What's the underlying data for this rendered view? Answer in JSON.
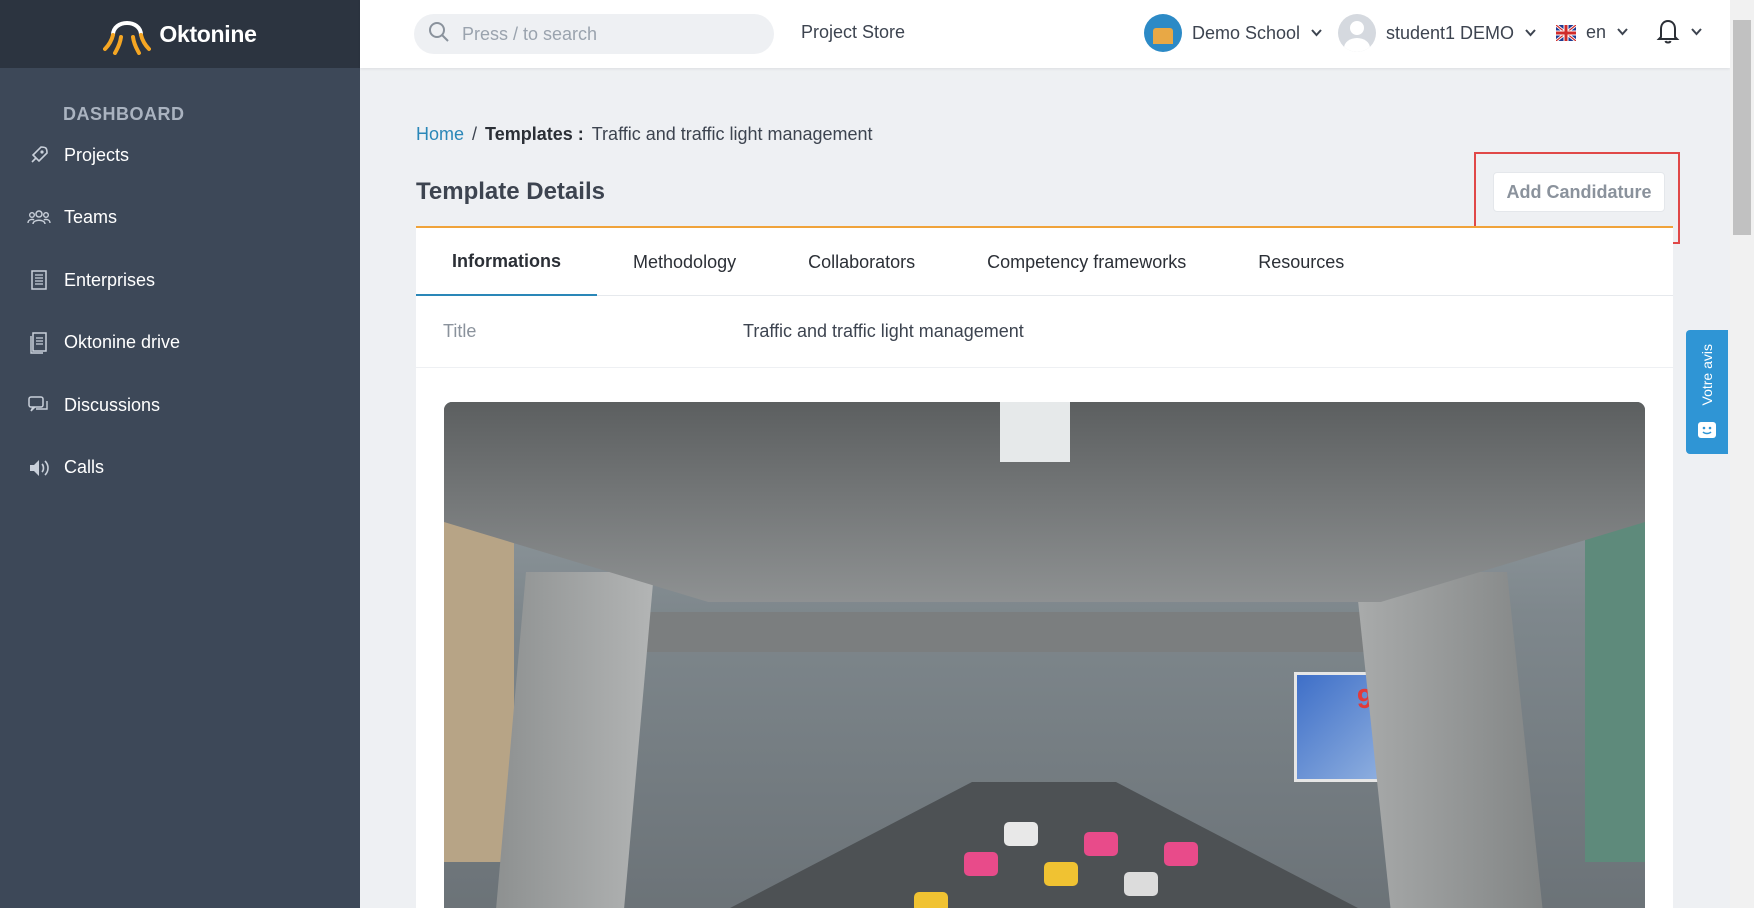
{
  "brand": {
    "name": "Oktonine",
    "logo_icon": "octopus-logo-icon",
    "accent": "#f5a623"
  },
  "sidebar": {
    "section": "DASHBOARD",
    "items": [
      {
        "label": "Projects",
        "icon": "rocket-icon"
      },
      {
        "label": "Teams",
        "icon": "users-icon"
      },
      {
        "label": "Enterprises",
        "icon": "building-icon"
      },
      {
        "label": "Oktonine drive",
        "icon": "drive-icon"
      },
      {
        "label": "Discussions",
        "icon": "chat-icon"
      },
      {
        "label": "Calls",
        "icon": "speaker-icon"
      }
    ]
  },
  "topbar": {
    "search_placeholder": "Press / to search",
    "project_store": "Project Store",
    "school": "Demo School",
    "user": "student1 DEMO",
    "language": "en"
  },
  "breadcrumb": {
    "home": "Home",
    "separator": "/",
    "section": "Templates :",
    "current": "Traffic and traffic light management"
  },
  "page": {
    "title": "Template Details",
    "add_button": "Add Candidature"
  },
  "tabs": [
    {
      "label": "Informations",
      "active": true
    },
    {
      "label": "Methodology",
      "active": false
    },
    {
      "label": "Collaborators",
      "active": false
    },
    {
      "label": "Competency frameworks",
      "active": false
    },
    {
      "label": "Resources",
      "active": false
    }
  ],
  "details": {
    "title_label": "Title",
    "title_value": "Traffic and traffic light management"
  },
  "photo": {
    "billboard_text": "92X"
  },
  "feedback": {
    "label": "Votre avis"
  },
  "colors": {
    "sidebar": "#3d4858",
    "sidebar_brand": "#2c3440",
    "link": "#2a87b8",
    "tab_accent": "#f0a33a",
    "highlight": "#e04848",
    "feedback": "#2f95d5"
  }
}
